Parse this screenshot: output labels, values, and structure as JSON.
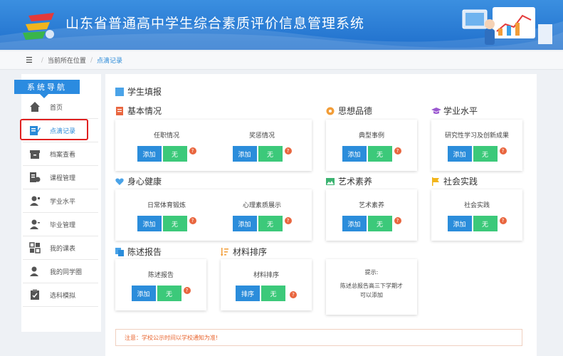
{
  "header": {
    "title": "山东省普通高中学生综合素质评价信息管理系统"
  },
  "breadcrumb": {
    "location_label": "当前所在位置",
    "current": "点滴记录"
  },
  "sidebar": {
    "title": "系统导航",
    "items": [
      {
        "label": "首页",
        "icon": "home-icon"
      },
      {
        "label": "点滴记录",
        "icon": "edit-icon"
      },
      {
        "label": "档案查看",
        "icon": "archive-icon"
      },
      {
        "label": "课程管理",
        "icon": "course-icon"
      },
      {
        "label": "学业水平",
        "icon": "user-icon"
      },
      {
        "label": "毕业管理",
        "icon": "user-icon"
      },
      {
        "label": "我的课表",
        "icon": "schedule-icon"
      },
      {
        "label": "我的同学圈",
        "icon": "user-icon"
      },
      {
        "label": "选科模拟",
        "icon": "clipboard-icon"
      }
    ]
  },
  "main": {
    "title": "学生填报",
    "add_label": "添加",
    "none_label": "无",
    "sort_label": "排序",
    "help_label": "?",
    "sections": {
      "basic": {
        "title": "基本情况",
        "items": [
          "任职情况",
          "奖惩情况"
        ]
      },
      "moral": {
        "title": "思想品德",
        "items": [
          "典型事例"
        ]
      },
      "academic": {
        "title": "学业水平",
        "items": [
          "研究性学习及创新成果"
        ]
      },
      "health": {
        "title": "身心健康",
        "items": [
          "日常体育锻炼",
          "心理素质展示"
        ]
      },
      "art": {
        "title": "艺术素养",
        "items": [
          "艺术素养"
        ]
      },
      "social": {
        "title": "社会实践",
        "items": [
          "社会实践"
        ]
      },
      "report": {
        "title": "陈述报告",
        "items": [
          "陈述报告"
        ]
      },
      "material": {
        "title": "材料排序",
        "items": [
          "材料排序"
        ]
      }
    },
    "tip": {
      "title": "提示:",
      "line1": "陈述总报告高三下学期才",
      "line2": "可以添加"
    },
    "notice": "注意：学校公示时间以学校通知为准!"
  },
  "colors": {
    "primary": "#2b8ddb",
    "success": "#3cc97a",
    "danger": "#e9663f",
    "highlight": "#e02020"
  }
}
